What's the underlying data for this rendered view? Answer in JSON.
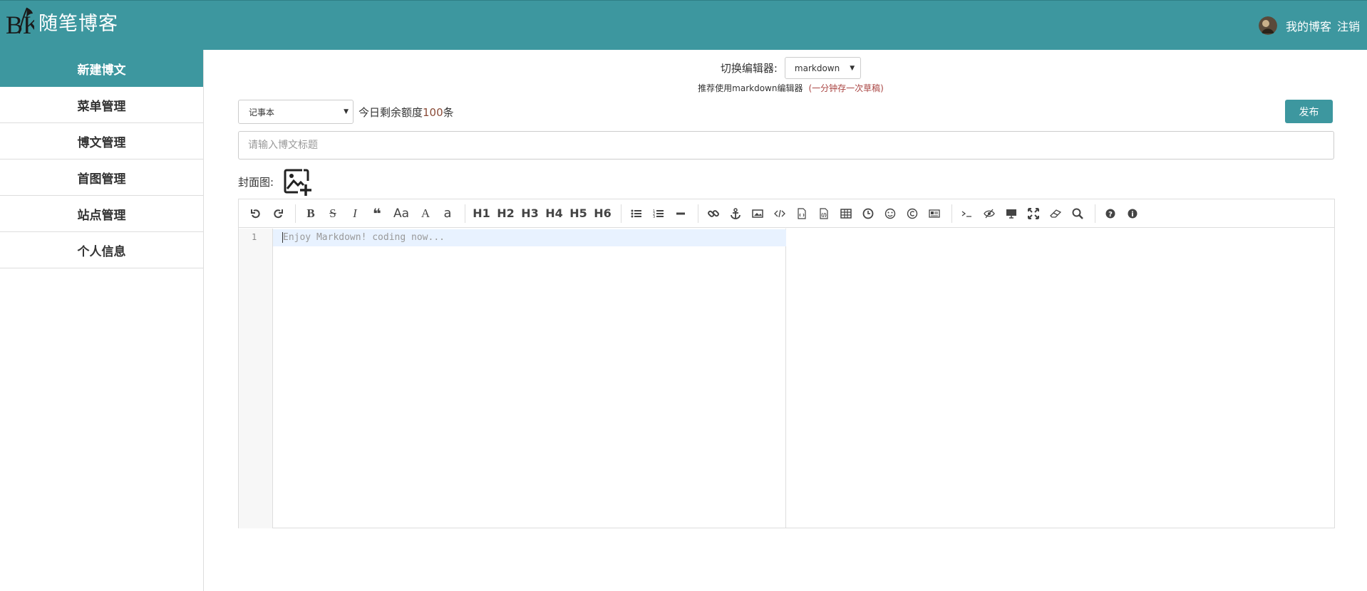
{
  "header": {
    "logo_mark": "BK",
    "site_name": "随笔博客",
    "my_blog": "我的博客",
    "logout": "注销"
  },
  "sidebar": {
    "items": [
      {
        "label": "新建博文",
        "active": true
      },
      {
        "label": "菜单管理"
      },
      {
        "label": "博文管理"
      },
      {
        "label": "首图管理"
      },
      {
        "label": "站点管理"
      },
      {
        "label": "个人信息"
      }
    ]
  },
  "editor_switch": {
    "label": "切换编辑器:",
    "selected": "markdown",
    "recommend": "推荐使用markdown编辑器",
    "tip": "(一分钟存一次草稿)"
  },
  "post": {
    "category_selected": "记事本",
    "quota_prefix": "今日剩余额度",
    "quota_num": "100",
    "quota_suffix": "条",
    "publish_label": "发布",
    "title_placeholder": "请输入博文标题",
    "cover_label": "封面图:"
  },
  "markdown": {
    "toolbar_headings": [
      "H1",
      "H2",
      "H3",
      "H4",
      "H5",
      "H6"
    ],
    "line_number": "1",
    "placeholder": "Enjoy Markdown! coding now..."
  },
  "colors": {
    "brand": "#3d979f",
    "tip": "#a94442"
  }
}
